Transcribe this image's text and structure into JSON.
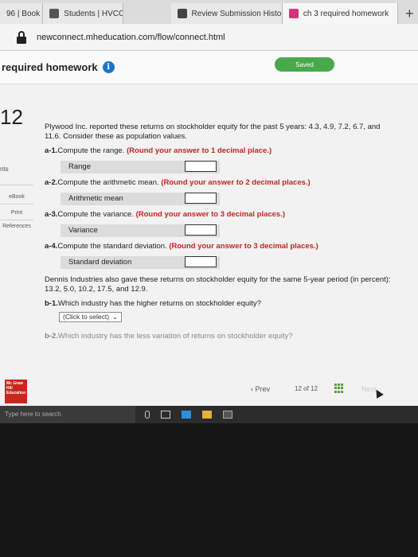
{
  "browser": {
    "tabs": [
      {
        "label": "96 | Book",
        "color": "#1e73c9"
      },
      {
        "label": "Students | HVCC",
        "color": "#555555"
      },
      {
        "label": "Review Submission History",
        "color": "#444444"
      },
      {
        "label": "ch 3 required homework",
        "color": "#d6337a",
        "active": true
      }
    ],
    "close_glyph": "×",
    "new_tab_glyph": "+",
    "url": "newconnect.mheducation.com/flow/connect.html"
  },
  "page": {
    "title": "required homework",
    "info_glyph": "i",
    "saved": "Saved",
    "question_number": "12",
    "side": {
      "points": "nts",
      "ebook": "eBook",
      "print": "Print",
      "references": "References"
    },
    "intro": "Plywood Inc. reported these returns on stockholder equity for the past 5 years: 4.3, 4.9, 7.2, 6.7, and 11.6. Consider these as population values.",
    "a1": {
      "num": "a-1.",
      "text": "Compute the range.",
      "hint": "(Round your answer to 1 decimal place.)",
      "field": "Range",
      "value": ""
    },
    "a2": {
      "num": "a-2.",
      "text": "Compute the arithmetic mean.",
      "hint": "(Round your answer to 2 decimal places.)",
      "field": "Arithmetic mean",
      "value": ""
    },
    "a3": {
      "num": "a-3.",
      "text": "Compute the variance.",
      "hint": "(Round your answer to 3 decimal places.)",
      "field": "Variance",
      "value": ""
    },
    "a4": {
      "num": "a-4.",
      "text": "Compute the standard deviation.",
      "hint": "(Round your answer to 3 decimal places.)",
      "field": "Standard deviation",
      "value": ""
    },
    "dennis": "Dennis Industries also gave these returns on stockholder equity for the same 5-year period (in percent): 13.2, 5.0, 10.2, 17.5, and 12.9.",
    "b1": {
      "num": "b-1.",
      "text": "Which industry has the higher returns on stockholder equity?",
      "select": "(Click to select)"
    },
    "b2": {
      "num": "b-2.",
      "text": "Which industry has the less variation of returns on stockholder equity?"
    },
    "footer": {
      "logo": "Mc Graw Hill Education",
      "prev": "Prev",
      "page": "12",
      "of": "of",
      "total": "12",
      "next": "Next"
    }
  },
  "taskbar": {
    "search_placeholder": "Type here to search"
  },
  "colors": {
    "hint_red": "#c0261f",
    "saved_green": "#48a94a",
    "info_blue": "#1e73c9",
    "logo_red": "#c8261e"
  }
}
